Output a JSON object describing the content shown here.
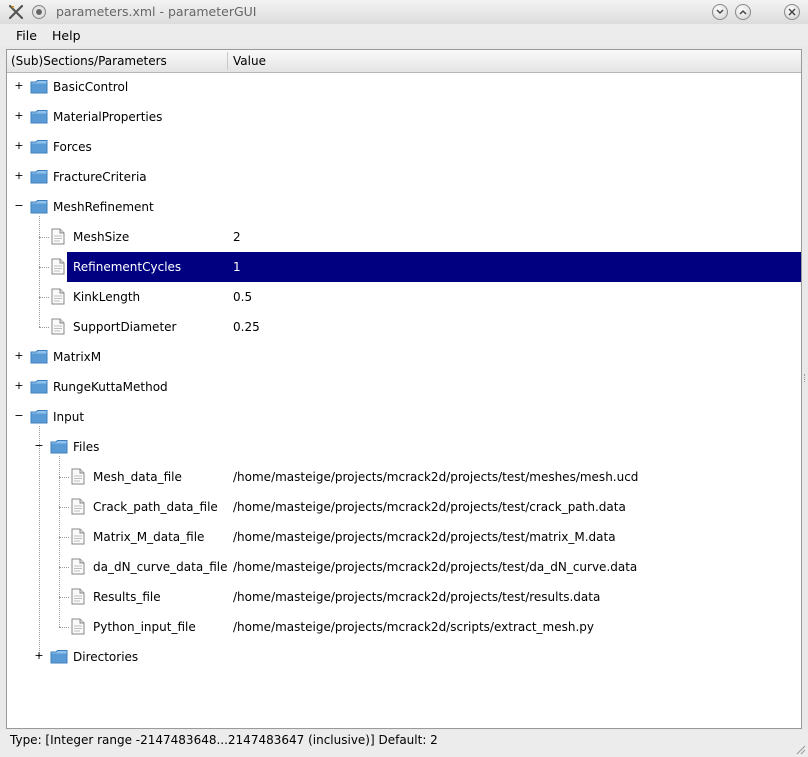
{
  "window": {
    "title": "parameters.xml - parameterGUI"
  },
  "menu": {
    "file_label": "File",
    "help_label": "Help"
  },
  "tree": {
    "col_param": "(Sub)Sections/Parameters",
    "col_value": "Value",
    "rows": [
      {
        "label": "BasicControl",
        "type": "folder",
        "level": 0,
        "expanded": false,
        "value": ""
      },
      {
        "label": "MaterialProperties",
        "type": "folder",
        "level": 0,
        "expanded": false,
        "value": ""
      },
      {
        "label": "Forces",
        "type": "folder",
        "level": 0,
        "expanded": false,
        "value": ""
      },
      {
        "label": "FractureCriteria",
        "type": "folder",
        "level": 0,
        "expanded": false,
        "value": ""
      },
      {
        "label": "MeshRefinement",
        "type": "folder",
        "level": 0,
        "expanded": true,
        "value": ""
      },
      {
        "label": "MeshSize",
        "type": "param",
        "level": 1,
        "value": "2"
      },
      {
        "label": "RefinementCycles",
        "type": "param",
        "level": 1,
        "value": "1",
        "selected": true
      },
      {
        "label": "KinkLength",
        "type": "param",
        "level": 1,
        "value": "0.5"
      },
      {
        "label": "SupportDiameter",
        "type": "param",
        "level": 1,
        "value": "0.25",
        "last": true
      },
      {
        "label": "MatrixM",
        "type": "folder",
        "level": 0,
        "expanded": false,
        "value": ""
      },
      {
        "label": "RungeKuttaMethod",
        "type": "folder",
        "level": 0,
        "expanded": false,
        "value": ""
      },
      {
        "label": "Input",
        "type": "folder",
        "level": 0,
        "expanded": true,
        "value": ""
      },
      {
        "label": "Files",
        "type": "folder",
        "level": 1,
        "expanded": true,
        "value": ""
      },
      {
        "label": "Mesh_data_file",
        "type": "param",
        "level": 2,
        "value": "/home/masteige/projects/mcrack2d/projects/test/meshes/mesh.ucd"
      },
      {
        "label": "Crack_path_data_file",
        "type": "param",
        "level": 2,
        "value": "/home/masteige/projects/mcrack2d/projects/test/crack_path.data"
      },
      {
        "label": "Matrix_M_data_file",
        "type": "param",
        "level": 2,
        "value": "/home/masteige/projects/mcrack2d/projects/test/matrix_M.data"
      },
      {
        "label": "da_dN_curve_data_file",
        "type": "param",
        "level": 2,
        "value": "/home/masteige/projects/mcrack2d/projects/test/da_dN_curve.data"
      },
      {
        "label": "Results_file",
        "type": "param",
        "level": 2,
        "value": "/home/masteige/projects/mcrack2d/projects/test/results.data"
      },
      {
        "label": "Python_input_file",
        "type": "param",
        "level": 2,
        "value": "/home/masteige/projects/mcrack2d/scripts/extract_mesh.py",
        "last": true
      },
      {
        "label": "Directories",
        "type": "folder",
        "level": 1,
        "expanded": false,
        "value": ""
      }
    ]
  },
  "status": {
    "text": "Type: [Integer range -2147483648...2147483647 (inclusive)]    Default: 2"
  },
  "colors": {
    "selection": "#000080",
    "folder": "#5b9bd5"
  }
}
